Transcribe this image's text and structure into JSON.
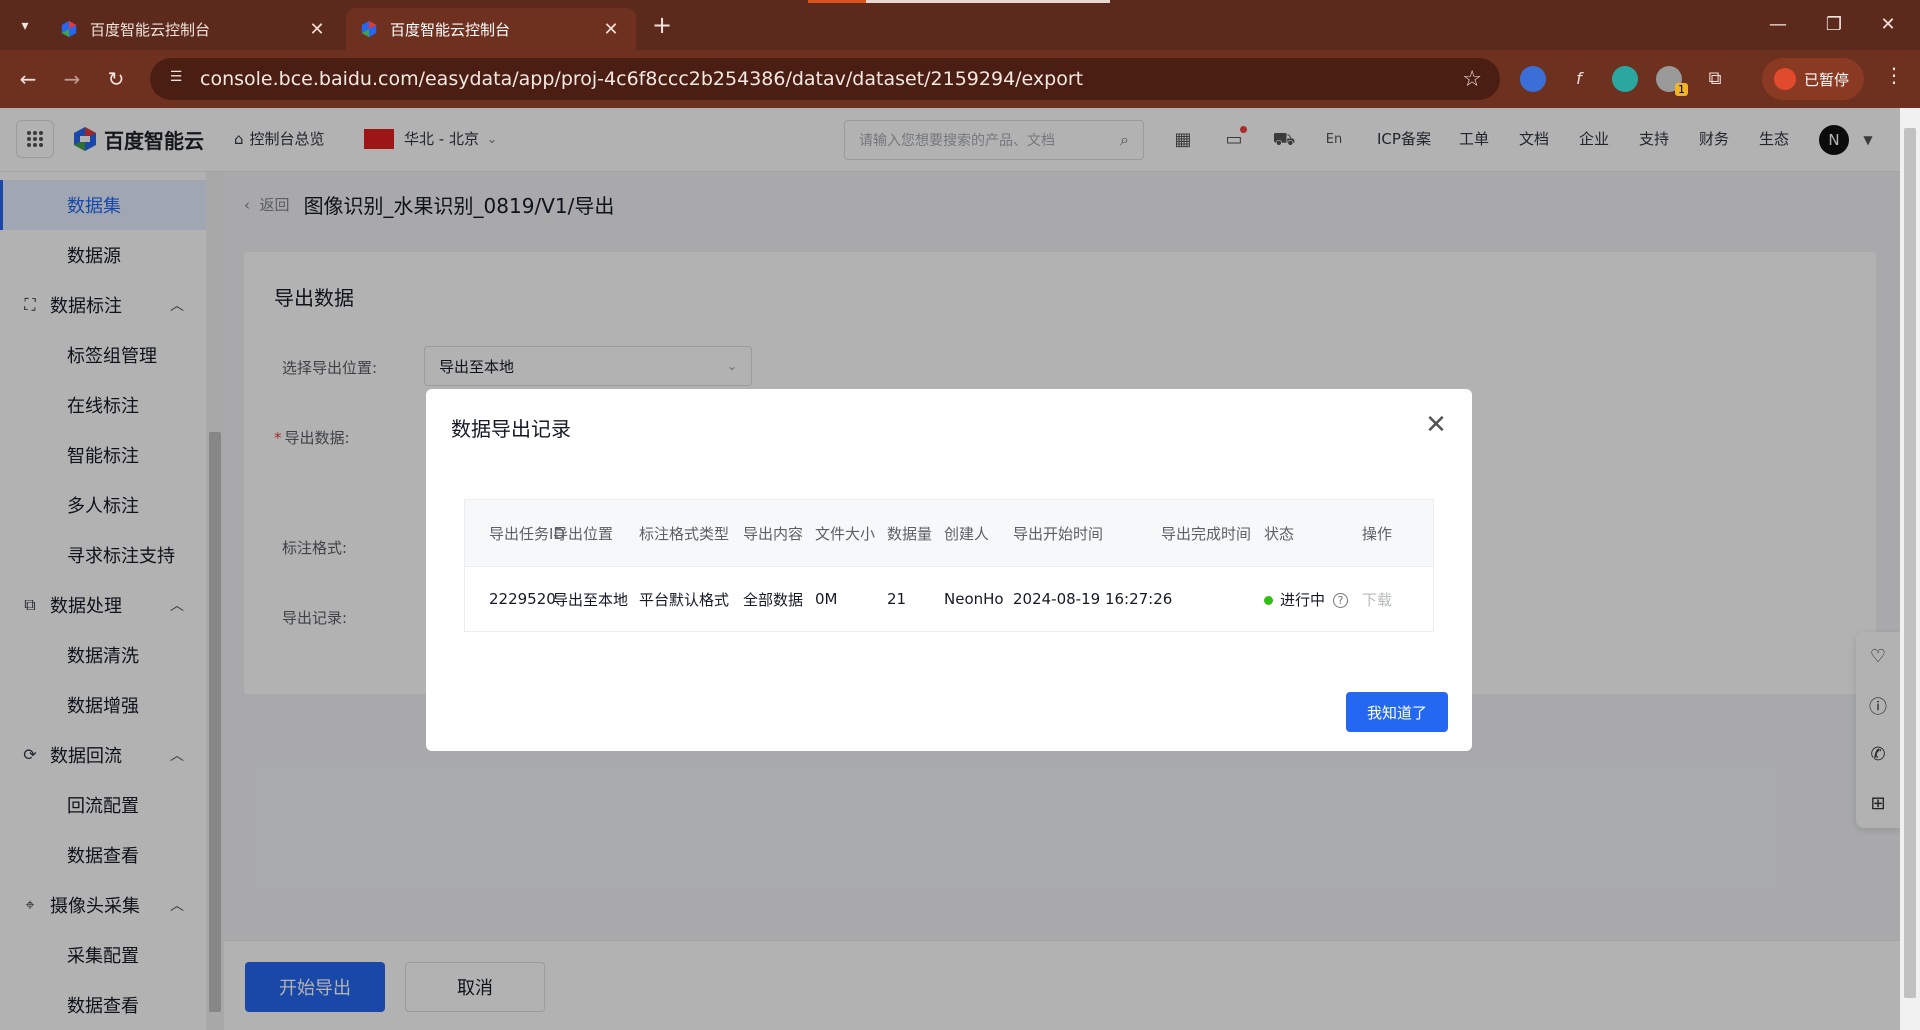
{
  "browser": {
    "tabs": [
      {
        "title": "百度智能云控制台",
        "active": false
      },
      {
        "title": "百度智能云控制台",
        "active": true
      }
    ],
    "url": "console.bce.baidu.com/easydata/app/proj-4c6f8ccc2b254386/datav/dataset/2159294/export",
    "paused_label": "已暂停",
    "extension_badge": "1"
  },
  "topnav": {
    "logo": "百度智能云",
    "console_home": "控制台总览",
    "region": "华北 - 北京",
    "search_placeholder": "请输入您想要搜索的产品、文档",
    "links": [
      "ICP备案",
      "工单",
      "文档",
      "企业",
      "支持",
      "财务",
      "生态"
    ],
    "avatar": "N"
  },
  "sidebar": {
    "items": [
      {
        "label": "数据集",
        "type": "sub",
        "active": true
      },
      {
        "label": "数据源",
        "type": "sub"
      },
      {
        "label": "数据标注",
        "type": "group",
        "icon": "scan-icon"
      },
      {
        "label": "标签组管理",
        "type": "sub"
      },
      {
        "label": "在线标注",
        "type": "sub"
      },
      {
        "label": "智能标注",
        "type": "sub"
      },
      {
        "label": "多人标注",
        "type": "sub"
      },
      {
        "label": "寻求标注支持",
        "type": "sub"
      },
      {
        "label": "数据处理",
        "type": "group",
        "icon": "process-icon"
      },
      {
        "label": "数据清洗",
        "type": "sub"
      },
      {
        "label": "数据增强",
        "type": "sub"
      },
      {
        "label": "数据回流",
        "type": "group",
        "icon": "refresh-icon"
      },
      {
        "label": "回流配置",
        "type": "sub"
      },
      {
        "label": "数据查看",
        "type": "sub"
      },
      {
        "label": "摄像头采集",
        "type": "group",
        "icon": "location-icon"
      },
      {
        "label": "采集配置",
        "type": "sub"
      },
      {
        "label": "数据查看",
        "type": "sub"
      }
    ]
  },
  "main": {
    "back_label": "返回",
    "page_title": "图像识别_水果识别_0819/V1/导出",
    "section_title": "导出数据",
    "export_location_label": "选择导出位置:",
    "export_location_value": "导出至本地",
    "export_data_label": "导出数据:",
    "annotation_format_label": "标注格式:",
    "export_record_label": "导出记录:"
  },
  "footer": {
    "start_export": "开始导出",
    "cancel": "取消"
  },
  "modal": {
    "title": "数据导出记录",
    "columns": [
      "导出任务ID",
      "导出位置",
      "标注格式类型",
      "导出内容",
      "文件大小",
      "数据量",
      "创建人",
      "导出开始时间",
      "导出完成时间",
      "状态",
      "操作"
    ],
    "rows": [
      {
        "id": "2229520",
        "location": "导出至本地",
        "format": "平台默认格式",
        "content": "全部数据",
        "size": "0M",
        "count": "21",
        "creator": "NeonHo",
        "start_time": "2024-08-19 16:27:26",
        "end_time": "",
        "status": "进行中",
        "action": "下载"
      }
    ],
    "confirm": "我知道了"
  },
  "colors": {
    "primary": "#2468f2",
    "status_running": "#30bf13",
    "browser_frame": "#5b2a1c"
  }
}
